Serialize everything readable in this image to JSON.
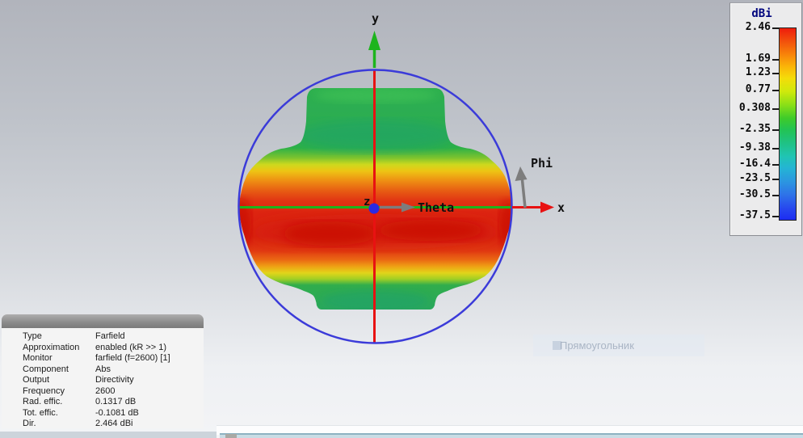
{
  "legend": {
    "title": "dBi",
    "ticks": [
      "2.46",
      "1.69",
      "1.23",
      "0.77",
      "0.308",
      "-2.35",
      "-9.38",
      "-16.4",
      "-23.5",
      "-30.5",
      "-37.5"
    ]
  },
  "axes": {
    "x": "x",
    "y": "y",
    "z": "z",
    "theta": "Theta",
    "phi": "Phi"
  },
  "info_panel": {
    "rows": [
      {
        "label": "Type",
        "value": "Farfield"
      },
      {
        "label": "Approximation",
        "value": "enabled (kR >> 1)"
      },
      {
        "label": "Monitor",
        "value": "farfield (f=2600) [1]"
      },
      {
        "label": "Component",
        "value": "Abs"
      },
      {
        "label": "Output",
        "value": "Directivity"
      },
      {
        "label": "Frequency",
        "value": "2600"
      },
      {
        "label": "Rad. effic.",
        "value": "0.1317 dB"
      },
      {
        "label": "Tot. effic.",
        "value": "-0.1081 dB"
      },
      {
        "label": "Dir.",
        "value": "2.464 dBi"
      }
    ]
  },
  "overlay": {
    "tool_label": "Прямоугольник"
  },
  "colors": {
    "axis_x": "#e81212",
    "axis_y": "#1db41d",
    "axis_z": "#2a2ae2",
    "sphere_circle": "#3b3bd9",
    "legend_title": "#00057e",
    "pattern_max": "#ee1c0c",
    "pattern_min": "#1c2cf2"
  }
}
